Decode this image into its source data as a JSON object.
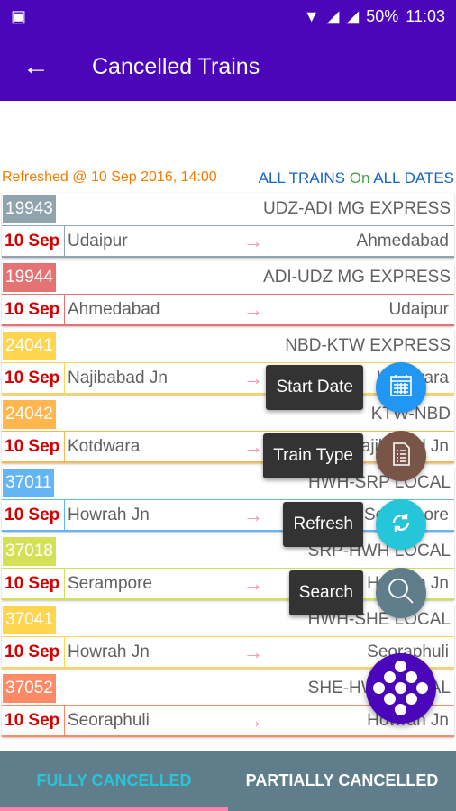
{
  "status": {
    "battery": "50%",
    "time": "11:03"
  },
  "appbar": {
    "title": "Cancelled Trains"
  },
  "info": {
    "refreshed": "Refreshed @ 10 Sep 2016, 14:00",
    "filter_trains": "ALL TRAINS",
    "filter_on": "On",
    "filter_dates": "ALL DATES"
  },
  "trains": [
    {
      "number": "19943",
      "name": "UDZ-ADI MG EXPRESS",
      "date": "10 Sep",
      "from": "Udaipur",
      "to": "Ahmedabad",
      "color": "#90a4ae"
    },
    {
      "number": "19944",
      "name": "ADI-UDZ MG EXPRESS",
      "date": "10 Sep",
      "from": "Ahmedabad",
      "to": "Udaipur",
      "color": "#e57373"
    },
    {
      "number": "24041",
      "name": "NBD-KTW EXPRESS",
      "date": "10 Sep",
      "from": "Najibabad Jn",
      "to": "Kotdwara",
      "color": "#ffd54f"
    },
    {
      "number": "24042",
      "name": "KTW-NBD",
      "date": "10 Sep",
      "from": "Kotdwara",
      "to": "Najibabad Jn",
      "color": "#ffb74d"
    },
    {
      "number": "37011",
      "name": "HWH-SRP LOCAL",
      "date": "10 Sep",
      "from": "Howrah Jn",
      "to": "Serampore",
      "color": "#64b5f6"
    },
    {
      "number": "37018",
      "name": "SRP-HWH LOCAL",
      "date": "10 Sep",
      "from": "Serampore",
      "to": "Howrah Jn",
      "color": "#d4e157"
    },
    {
      "number": "37041",
      "name": "HWH-SHE LOCAL",
      "date": "10 Sep",
      "from": "Howrah Jn",
      "to": "Seoraphuli",
      "color": "#ffd54f"
    },
    {
      "number": "37052",
      "name": "SHE-HWH LOCAL",
      "date": "10 Sep",
      "from": "Seoraphuli",
      "to": "Howrah Jn",
      "color": "#ff8a65"
    }
  ],
  "fab_menu": [
    {
      "label": "Start Date",
      "icon": "calendar-icon",
      "color": "#2196f3"
    },
    {
      "label": "Train Type",
      "icon": "list-document-icon",
      "color": "#795548"
    },
    {
      "label": "Refresh",
      "icon": "refresh-icon",
      "color": "#26c6da"
    },
    {
      "label": "Search",
      "icon": "search-icon",
      "color": "#607d8b"
    }
  ],
  "tabs": [
    {
      "label": "FULLY CANCELLED",
      "active": true
    },
    {
      "label": "PARTIALLY CANCELLED",
      "active": false
    }
  ]
}
